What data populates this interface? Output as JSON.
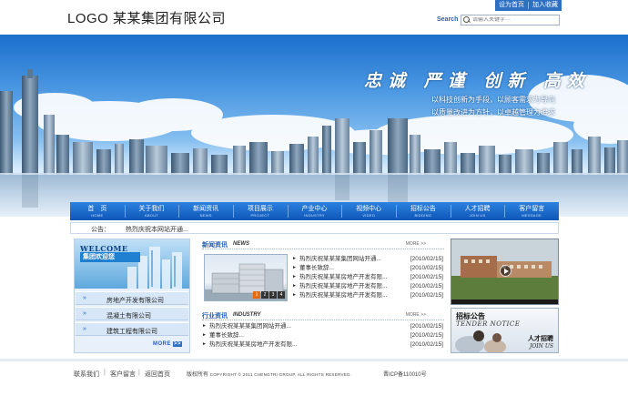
{
  "header": {
    "logo": "LOGO 某某集团有限公司",
    "toplinks": [
      "设为首页",
      "加入收藏"
    ],
    "search_label": "Search",
    "search_placeholder": "请输入关键字···"
  },
  "banner": {
    "slogan": "忠诚 严谨 创新 高效",
    "sub1": "以科技创新为手段，以顾客需求为导向",
    "sub2": "以质量改进为方针，以卓越管理为追求"
  },
  "nav": [
    {
      "cn": "首　页",
      "en": "HOME"
    },
    {
      "cn": "关于我们",
      "en": "ABOUT"
    },
    {
      "cn": "新闻资讯",
      "en": "NEWS"
    },
    {
      "cn": "项目展示",
      "en": "PROJECT"
    },
    {
      "cn": "产业中心",
      "en": "INDUSTRY"
    },
    {
      "cn": "视频中心",
      "en": "VIDEO"
    },
    {
      "cn": "招标公告",
      "en": "BIDDING"
    },
    {
      "cn": "人才招聘",
      "en": "JOIN US"
    },
    {
      "cn": "客户留言",
      "en": "MESSAGE"
    }
  ],
  "notice": {
    "label": "公告：",
    "text": "热烈庆祝本网站开通..."
  },
  "left": {
    "welcome": "WELCOME",
    "welcome_sub": "集团欢迎您",
    "categories": [
      "房地产开发有限公司",
      "混凝土有限公司",
      "建筑工程有限公司"
    ],
    "more_label": "MORE",
    "more_btn": ">>"
  },
  "news": {
    "title_cn": "新闻资讯",
    "title_en": "NEWS",
    "more": "MORE >>",
    "pager": [
      "1",
      "2",
      "3",
      "4"
    ],
    "items": [
      {
        "title": "热烈庆祝某某某集团网站开通...",
        "date": "[2010/02/15]"
      },
      {
        "title": "董事长致辞...",
        "date": "[2010/02/15]"
      },
      {
        "title": "热烈庆祝某某某房地产开发有限...",
        "date": "[2010/02/15]"
      },
      {
        "title": "热烈庆祝某某某房地产开发有限...",
        "date": "[2010/02/15]"
      },
      {
        "title": "热烈庆祝某某某房地产开发有限...",
        "date": "[2010/02/15]"
      }
    ]
  },
  "industry": {
    "title_cn": "行业资讯",
    "title_en": "INDUSTRY",
    "more": "MORE >>",
    "items": [
      {
        "title": "热烈庆祝某某某集团网站开通...",
        "date": "[2010/02/15]"
      },
      {
        "title": "董事长致辞...",
        "date": "[2010/02/15]"
      },
      {
        "title": "热烈庆祝某某某房地产开发有限...",
        "date": "[2010/02/15]"
      }
    ]
  },
  "right": {
    "tender_cn": "招标公告",
    "tender_en": "TENDER NOTICE",
    "recruit_cn": "人才招聘",
    "recruit_en": "JOIN US"
  },
  "footer": {
    "links": [
      "联系我们",
      "客户留言",
      "返回首页"
    ],
    "copy_cn": "版权所有",
    "copy_en": "COPYRIGHT © 2011 CHENGTRI GROUP. ALL RIGHTS RESERVED.",
    "icp": "晋ICP备110010号"
  }
}
